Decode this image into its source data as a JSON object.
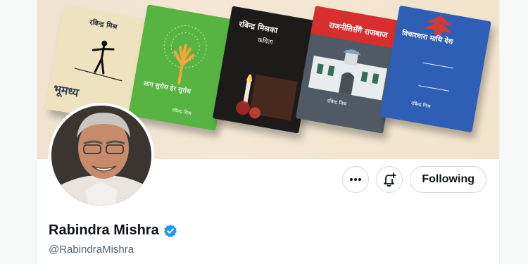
{
  "profile": {
    "display_name": "Rabindra Mishra",
    "handle": "@RabindraMishra",
    "verified": true
  },
  "actions": {
    "more_icon": "more-horizontal-icon",
    "notify_icon": "bell-plus-icon",
    "follow_label": "Following"
  },
  "banner": {
    "books": [
      {
        "title": "रबिन्द्र मिश्र",
        "bottom_title": "भूमध्य"
      },
      {
        "title": "लाग सुरोस हेर सुरोस",
        "author": "रबिन्द्र मिश्र"
      },
      {
        "title": "रबिन्द्र मिश्रका",
        "subtitle": "कविता"
      },
      {
        "title": "राजनीतिसँगै राजबाज",
        "author": "रबिन्द्र मिश्र"
      },
      {
        "title": "विचारधारा माथि देश",
        "author": "रबिन्द्र मिश्र"
      }
    ]
  },
  "colors": {
    "verified_badge": "#1d9bf0",
    "text_primary": "#0f1419",
    "text_secondary": "#536471",
    "border": "#cfd9de"
  }
}
